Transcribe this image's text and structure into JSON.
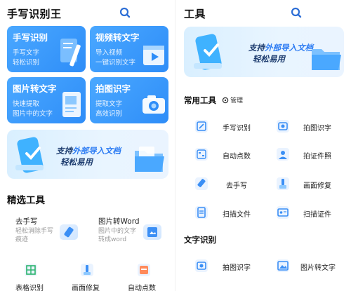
{
  "left": {
    "app_title": "手写识别王",
    "cards": [
      {
        "title": "手写识别",
        "sub1": "手写文字",
        "sub2": "轻松识别"
      },
      {
        "title": "视频转文字",
        "sub1": "导入视频",
        "sub2": "一键识别文字"
      },
      {
        "title": "图片转文字",
        "sub1": "快速提取",
        "sub2": "图片中的文字"
      },
      {
        "title": "拍图识字",
        "sub1": "提取文字",
        "sub2": "高效识别"
      }
    ],
    "banner": {
      "line1_a": "支持",
      "line1_b": "外部导入文档",
      "line2": "轻松易用"
    },
    "featured_title": "精选工具",
    "featured": [
      {
        "title": "去手写",
        "sub1": "轻松消除手写",
        "sub2": "痕迹"
      },
      {
        "title": "图片转Word",
        "sub1": "图片中的文字",
        "sub2": "转成word"
      }
    ],
    "bottom": [
      {
        "label": "表格识别"
      },
      {
        "label": "画面修复"
      },
      {
        "label": "自动点数"
      }
    ]
  },
  "right": {
    "title": "工具",
    "banner": {
      "line1_a": "支持",
      "line1_b": "外部导入文档",
      "line2": "轻松易用"
    },
    "common_title": "常用工具",
    "manage_label": "管理",
    "common_tools": [
      {
        "label": "手写识别",
        "icon": "pen-icon"
      },
      {
        "label": "拍图识字",
        "icon": "camera-scan-icon"
      },
      {
        "label": "自动点数",
        "icon": "count-icon"
      },
      {
        "label": "拍证件照",
        "icon": "id-photo-icon"
      },
      {
        "label": "去手写",
        "icon": "eraser-icon"
      },
      {
        "label": "画面修复",
        "icon": "repair-icon"
      },
      {
        "label": "扫描文件",
        "icon": "scan-file-icon"
      },
      {
        "label": "扫描证件",
        "icon": "scan-id-icon"
      }
    ],
    "text_title": "文字识别",
    "text_tools": [
      {
        "label": "拍图识字",
        "icon": "camera-scan-icon"
      },
      {
        "label": "图片转文字",
        "icon": "image-text-icon"
      }
    ]
  },
  "colors": {
    "accent": "#2e8df8",
    "card_bg": "#3b9bff",
    "banner_bg": "#dff0ff",
    "highlight": "#2d7cf3"
  }
}
